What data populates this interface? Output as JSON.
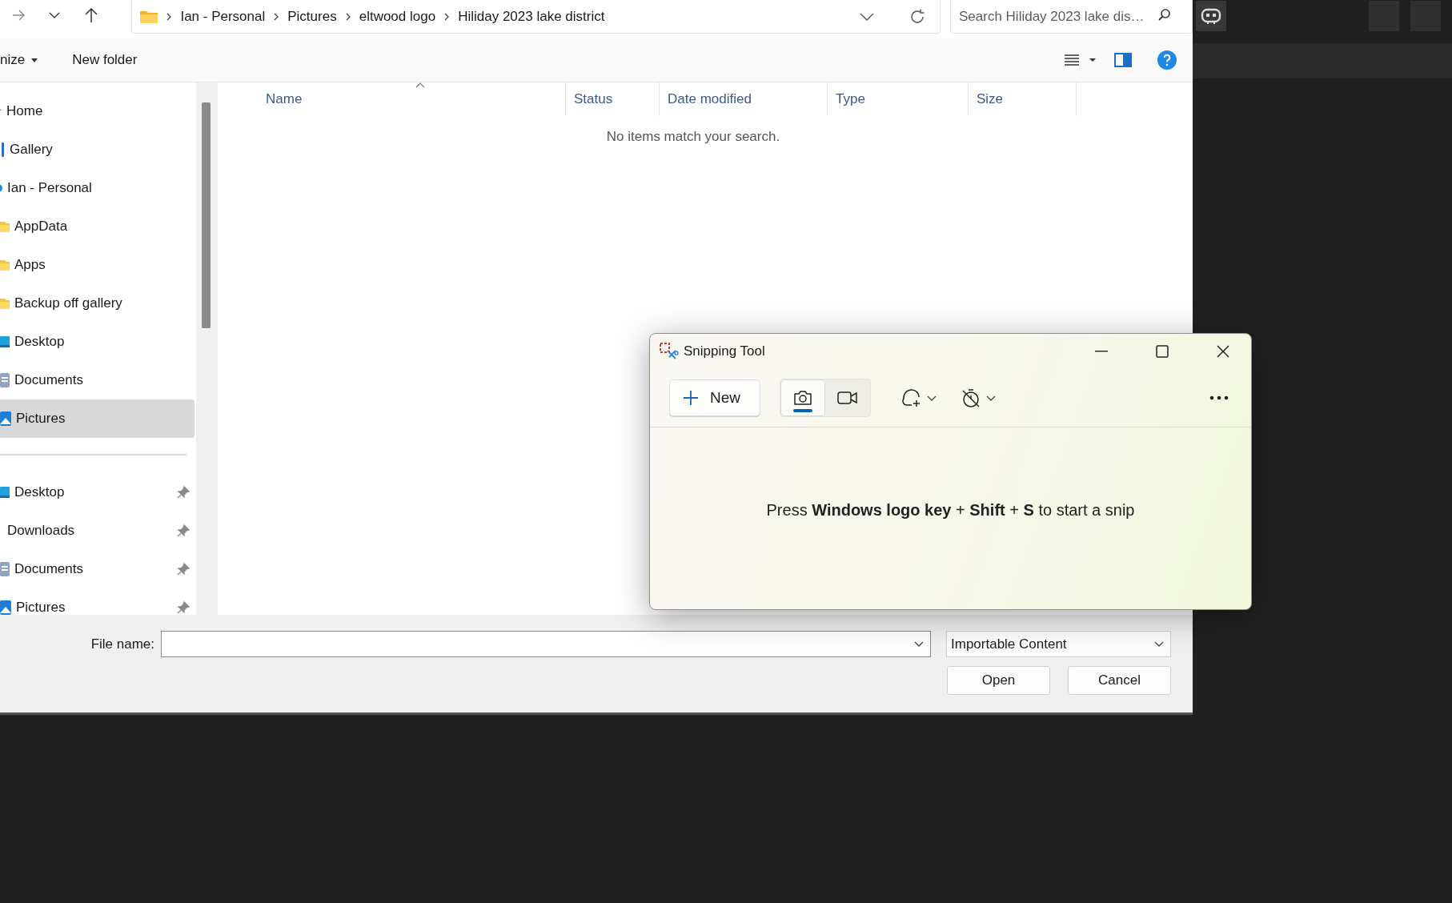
{
  "breadcrumb": [
    "Ian - Personal",
    "Pictures",
    "eltwood logo",
    "Hiliday 2023 lake district"
  ],
  "search": {
    "placeholder": "Search Hiliday 2023 lake dis…"
  },
  "command_bar": {
    "organize": "nize",
    "new_folder": "New folder"
  },
  "sidebar": {
    "items": [
      {
        "label": "Home",
        "kind": "home",
        "selected": false
      },
      {
        "label": "Gallery",
        "kind": "gallery",
        "selected": false
      },
      {
        "label": "Ian - Personal",
        "kind": "cloud",
        "selected": false,
        "children": [
          {
            "label": "AppData",
            "kind": "folder",
            "selected": false
          },
          {
            "label": "Apps",
            "kind": "folder",
            "selected": false
          },
          {
            "label": "Backup off gallery",
            "kind": "folder",
            "selected": false
          },
          {
            "label": "Desktop",
            "kind": "desktop",
            "selected": false
          },
          {
            "label": "Documents",
            "kind": "documents",
            "selected": false
          },
          {
            "label": "Pictures",
            "kind": "pictures",
            "selected": true
          }
        ]
      }
    ],
    "pinned": [
      {
        "label": "Desktop",
        "kind": "desktop",
        "selected": false
      },
      {
        "label": "Downloads",
        "kind": "plain",
        "selected": false
      },
      {
        "label": "Documents",
        "kind": "documents",
        "selected": false
      },
      {
        "label": "Pictures",
        "kind": "pictures",
        "selected": false
      }
    ]
  },
  "table": {
    "columns": [
      "Name",
      "Status",
      "Date modified",
      "Type",
      "Size"
    ],
    "empty_message": "No items match your search."
  },
  "footer": {
    "file_name_label": "File name:",
    "file_type": "Importable Content",
    "buttons": [
      "Open",
      "Cancel"
    ]
  },
  "snipping_tool": {
    "title": "Snipping Tool",
    "new_button": "New",
    "modes": [
      {
        "kind": "photo",
        "selected": true
      },
      {
        "kind": "video",
        "selected": false
      }
    ],
    "hint": "Press **Windows logo key** + **Shift** + **S** to start a snip"
  }
}
